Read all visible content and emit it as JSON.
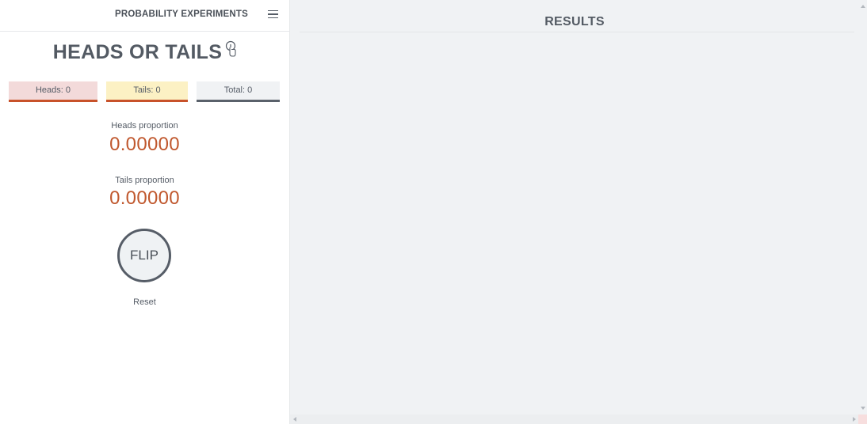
{
  "header": {
    "app_title": "PROBABILITY EXPERIMENTS",
    "menu_icon": "hamburger-menu-icon"
  },
  "experiment": {
    "title": "HEADS OR TAILS",
    "info_icon": "info-pointer-icon"
  },
  "counters": {
    "heads": "Heads: 0",
    "tails": "Tails: 0",
    "total": "Total: 0"
  },
  "proportions": {
    "heads_label": "Heads proportion",
    "heads_value": "0.00000",
    "tails_label": "Tails proportion",
    "tails_value": "0.00000"
  },
  "actions": {
    "flip_label": "FLIP",
    "reset_label": "Reset"
  },
  "results": {
    "title": "RESULTS"
  },
  "colors": {
    "heads_bg": "#f3dada",
    "tails_bg": "#fcf1c4",
    "total_bg": "#f0f2f4",
    "accent": "#c0582e",
    "text": "#555c66",
    "results_bg": "#f0f2f4"
  }
}
